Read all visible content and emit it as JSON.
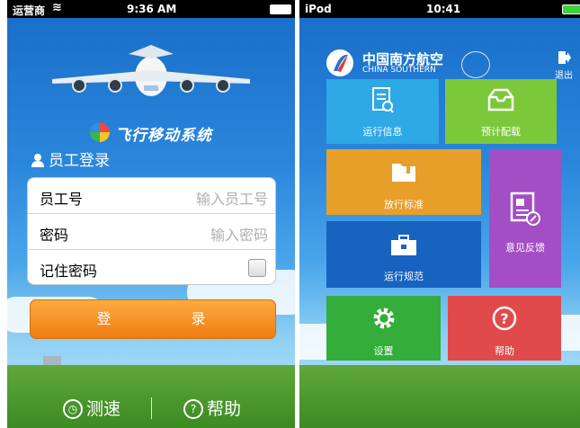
{
  "left": {
    "status": {
      "carrier": "运营商",
      "time": "9:36 AM"
    },
    "app_title": "飞行移动系统",
    "login_title": "员工登录",
    "fields": {
      "employee_label": "员工号",
      "employee_placeholder": "输入员工号",
      "password_label": "密码",
      "password_placeholder": "输入密码",
      "remember_label": "记住密码"
    },
    "login_button": "登 录",
    "speed_test": "测速",
    "help": "帮助"
  },
  "right": {
    "status": {
      "device": "iPod",
      "time": "10:41"
    },
    "brand_cn": "中国南方航空",
    "brand_en": "CHINA SOUTHERN",
    "logout": "退出",
    "tiles": {
      "flight_info": "运行信息",
      "loading": "预计配载",
      "release_std": "放行标准",
      "feedback": "意见反馈",
      "ops_rules": "运行规范",
      "settings": "设置",
      "help": "帮助"
    },
    "colors": {
      "flight_info": "#2fa8e6",
      "loading": "#7cc83b",
      "release_std": "#e89f2a",
      "feedback": "#a34ec5",
      "ops_rules": "#1763bf",
      "settings": "#34ad3a",
      "help": "#e14a4a"
    }
  }
}
